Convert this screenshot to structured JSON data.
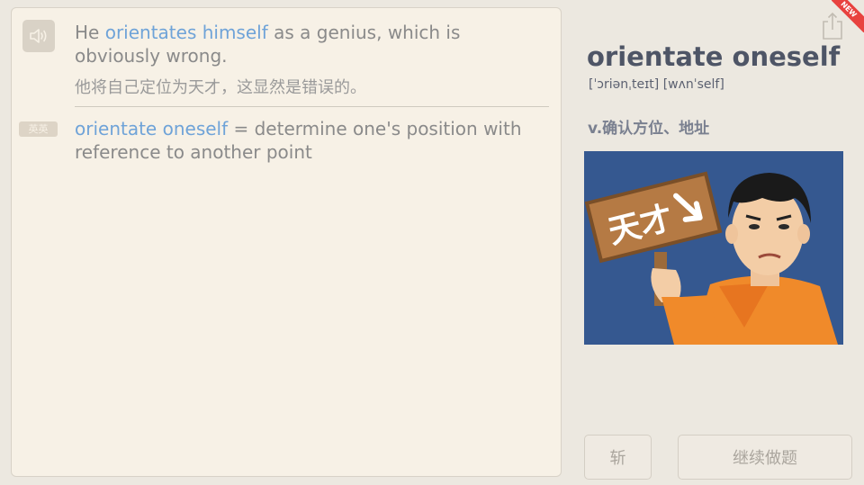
{
  "example": {
    "before": "He ",
    "highlight": "orientates himself",
    "after": " as a genius, which is obviously wrong.",
    "translation": "他将自己定位为天才，这显然是错误的。"
  },
  "definition": {
    "tag": "英英",
    "term": "orientate oneself",
    "text": " = determine one's position with reference to another point"
  },
  "word": {
    "headword": "orientate oneself",
    "phonetic": "[ˈɔriənˌteɪt] [wʌnˈself]",
    "part_of_speech": "v.确认方位、地址"
  },
  "illustration": {
    "sign_text": "天才"
  },
  "badge": {
    "new": "NEW"
  },
  "buttons": {
    "cut": "斩",
    "continue": "继续做题"
  },
  "colors": {
    "highlight": "#6fa3d8",
    "background": "#ece8e0",
    "card": "#f7f1e6",
    "badge": "#e8423f"
  }
}
